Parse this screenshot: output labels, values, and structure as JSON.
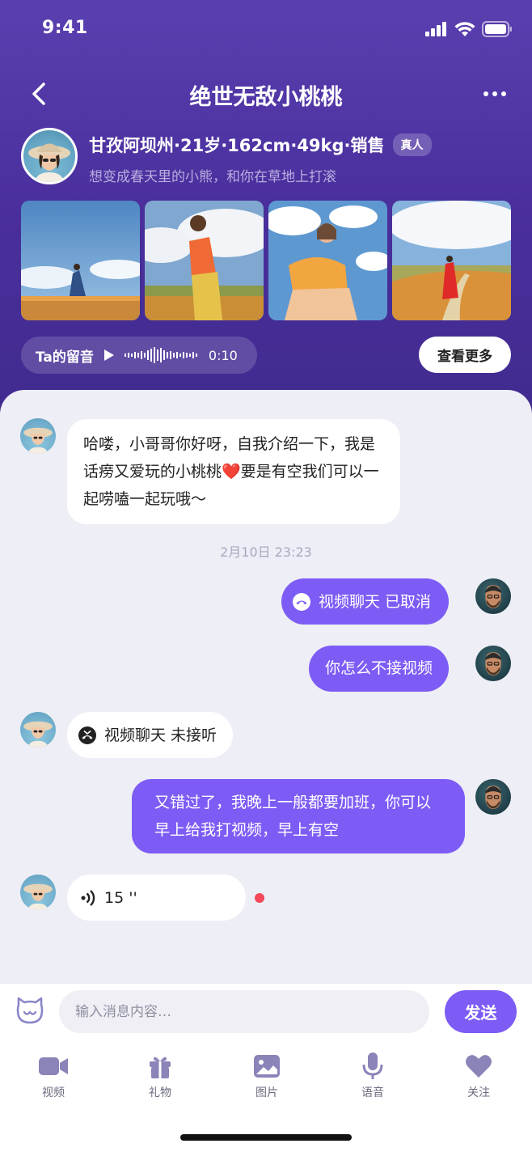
{
  "status_bar": {
    "time": "9:41"
  },
  "nav": {
    "title": "绝世无敌小桃桃"
  },
  "profile": {
    "name_line": "甘孜阿坝州·21岁·162cm·49kg·销售",
    "verified_badge": "真人",
    "signature": "想变成春天里的小熊，和你在草地上打滚"
  },
  "voice_intro": {
    "label": "Ta的留音",
    "duration": "0:10"
  },
  "see_more_label": "查看更多",
  "messages": {
    "m1": "哈喽，小哥哥你好呀，自我介绍一下，我是话痨又爱玩的小桃桃❤️要是有空我们可以一起唠嗑一起玩哦～",
    "time_divider": "2月10日 23:23",
    "m2": "视频聊天 已取消",
    "m3": "你怎么不接视频",
    "m4": "视频聊天 未接听",
    "m5": "又错过了，我晚上一般都要加班，你可以早上给我打视频，早上有空",
    "m6": "15 ''"
  },
  "input": {
    "placeholder": "输入消息内容…",
    "send_label": "发送"
  },
  "toolbar": [
    {
      "label": "视频",
      "icon": "video-icon"
    },
    {
      "label": "礼物",
      "icon": "gift-icon"
    },
    {
      "label": "图片",
      "icon": "image-icon"
    },
    {
      "label": "语音",
      "icon": "mic-icon"
    },
    {
      "label": "关注",
      "icon": "heart-icon"
    }
  ],
  "colors": {
    "header": "#4a2f9d",
    "accent": "#7d5cf5",
    "chat_bg": "#edeef6",
    "unread": "#f4485a"
  }
}
